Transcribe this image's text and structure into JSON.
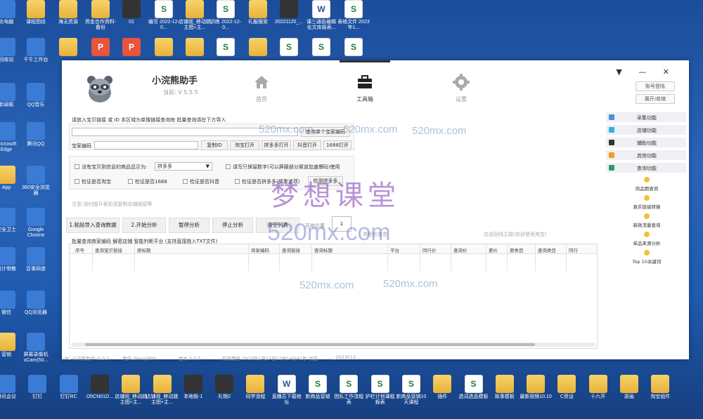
{
  "watermarks": {
    "big": "梦想课堂",
    "mid": "520mx.com",
    "small": "520mx.com"
  },
  "desktop_top_row": [
    {
      "label": "此电脑",
      "type": "app"
    },
    {
      "label": "课程图纹",
      "type": "folder"
    },
    {
      "label": "海无资源",
      "type": "folder"
    },
    {
      "label": "资金合作资料-备份",
      "type": "folder"
    },
    {
      "label": "01",
      "type": "dark"
    },
    {
      "label": "编写 2022-12-0...",
      "type": "excel"
    },
    {
      "label": "店铺视_移动跳主图+主...",
      "type": "folder"
    },
    {
      "label": "训练 2022-12-0...",
      "type": "excel"
    },
    {
      "label": "礼服搜索",
      "type": "folder"
    },
    {
      "label": "20221120_...",
      "type": "dark"
    },
    {
      "label": "课三通告编辑化文库报表...",
      "type": "word"
    },
    {
      "label": "表格文件 2023年1...",
      "type": "excel"
    }
  ],
  "desktop_second_row": [
    {
      "label": "回收站",
      "type": "app"
    },
    {
      "label": "千牛工作台",
      "type": "app"
    },
    {
      "label": "",
      "type": "folder"
    },
    {
      "label": "",
      "type": "ppt"
    },
    {
      "label": "",
      "type": "ppt"
    },
    {
      "label": "",
      "type": "folder"
    },
    {
      "label": "",
      "type": "folder"
    },
    {
      "label": "",
      "type": "excel"
    },
    {
      "label": "",
      "type": "folder"
    },
    {
      "label": "",
      "type": "excel"
    },
    {
      "label": "",
      "type": "excel"
    },
    {
      "label": "",
      "type": "excel"
    }
  ],
  "desktop_left_column": [
    {
      "label": "新闻板",
      "type": "app"
    },
    {
      "label": "Microsoft Edge",
      "type": "app"
    },
    {
      "label": "App",
      "type": "folder"
    },
    {
      "label": "安全卫士",
      "type": "app"
    },
    {
      "label": "设计带教",
      "type": "app"
    },
    {
      "label": "微信",
      "type": "app"
    },
    {
      "label": "营销",
      "type": "folder"
    }
  ],
  "desktop_second_column": [
    {
      "label": "QQ音乐",
      "type": "app"
    },
    {
      "label": "腾讯QQ",
      "type": "app"
    },
    {
      "label": "360安全浏览器",
      "type": "app"
    },
    {
      "label": "Google Chrome",
      "type": "app"
    },
    {
      "label": "百事网盘",
      "type": "app"
    },
    {
      "label": "QQ浏览器",
      "type": "app"
    },
    {
      "label": "屏幕录像机 oCam(50...",
      "type": "app"
    }
  ],
  "taskbar_row": [
    {
      "label": "腾讯会议",
      "type": "app"
    },
    {
      "label": "钉钉",
      "type": "app"
    },
    {
      "label": "钉钉RC",
      "type": "app"
    },
    {
      "label": "O5CN01D...",
      "type": "dark"
    },
    {
      "label": "店铺视_移动跳主图+主...",
      "type": "folder"
    },
    {
      "label": "店铺视_移动跳主图+主...",
      "type": "folder"
    },
    {
      "label": "本地板-1",
      "type": "dark"
    },
    {
      "label": "礼物2",
      "type": "dark"
    },
    {
      "label": "同学流程",
      "type": "folder"
    },
    {
      "label": "直播员下载地址",
      "type": "word"
    },
    {
      "label": "新商品营销",
      "type": "excel"
    },
    {
      "label": "团队工作流程表",
      "type": "excel"
    },
    {
      "label": "护栏计划课程报表",
      "type": "excel"
    },
    {
      "label": "新商品营销10天课程",
      "type": "excel"
    },
    {
      "label": "插件",
      "type": "folder"
    },
    {
      "label": "选词选品模板",
      "type": "excel"
    },
    {
      "label": "故事模板",
      "type": "folder"
    },
    {
      "label": "最新视频10.10",
      "type": "folder"
    },
    {
      "label": "C资设",
      "type": "folder"
    },
    {
      "label": "十六开",
      "type": "folder"
    },
    {
      "label": "原画",
      "type": "folder"
    },
    {
      "label": "淘宝组件",
      "type": "folder"
    }
  ],
  "app": {
    "title": "小浣熊助手",
    "version": "当前: V 5.5.5",
    "nav": [
      {
        "label": "首页",
        "icon": "home-icon"
      },
      {
        "label": "工具箱",
        "icon": "toolbox-icon"
      },
      {
        "label": "设置",
        "icon": "gear-icon"
      }
    ],
    "window_controls": "▼ — ✕",
    "user_buttons": [
      "账号登陆",
      "展开/收缩"
    ],
    "input_section": {
      "label": "请放入宝贝链接 或 ID 本区域为单搜链接查询地 批量查询请在下方导入",
      "query_button": "查询单个宝家编码",
      "code_label": "宝家编码",
      "buttons": [
        "复制ID",
        "淘宝打开",
        "拼多多打开",
        "抖音打开",
        "1688打开"
      ]
    },
    "options": {
      "check_main": "没有宝贝到信息的商品显示为:",
      "select_value": "拼多多",
      "check_right": "请写只保留数字(可以屏蔽部分渠道加速爆码)使用",
      "check_row": [
        "检证是否淘宝",
        "检证是否1688",
        "检证是否抖音",
        "检证是否拼多多(慎重选项)"
      ],
      "platform_button": "检测拼多多"
    },
    "note": "注意:请扫描开表前请复制店铺链接等",
    "actions": [
      "1.粘贴导入查询数据",
      "2.开始分析",
      "暂停分析",
      "停止分析",
      "清空列表"
    ],
    "start_pos_label": "开始位置",
    "start_pos_value": "1",
    "mid_label": "类型检查查",
    "right_label": "总店回线主题(欢迎使用淘宝)",
    "table_caption": "批量查询商家编码 解密店铺 智能判断平台 (支持直接拖入TXT文件)",
    "table_headers": [
      "序号",
      "查询宝贝链接",
      "原标题",
      "商家编码",
      "查询链接",
      "查询标题",
      "平台",
      "同行价",
      "查询价",
      "差价",
      "原类目",
      "查询类目",
      "同行"
    ],
    "status": [
      "PC-小浣熊助手v5.5.5",
      "用户:zheng999",
      "版本:5.5.5",
      "有效期至:2023年1月27日11时14分41秒 状态",
      "_2023012..."
    ]
  },
  "sidebar": {
    "menus": [
      {
        "label": "采集功能",
        "icon": "collect-icon",
        "color": "#4a8fd8"
      },
      {
        "label": "店铺功能",
        "icon": "shop-icon",
        "color": "#3ab0e0"
      },
      {
        "label": "辅助功能",
        "icon": "assist-icon",
        "color": "#333333"
      },
      {
        "label": "其他功能",
        "icon": "other-icon",
        "color": "#f0a020"
      },
      {
        "label": "查询功能",
        "icon": "query-icon",
        "color": "#2a9a6a"
      }
    ],
    "features": [
      "商品图查询",
      "真实链接转换",
      "新款流量查询",
      "单品来源分析",
      "Top 10关键词"
    ]
  }
}
